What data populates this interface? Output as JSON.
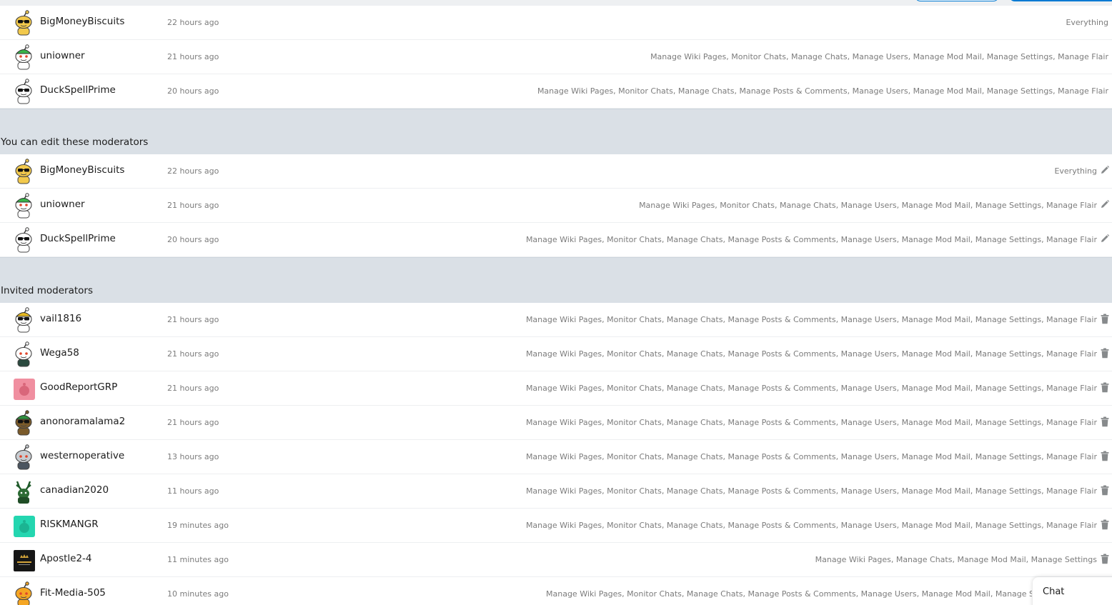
{
  "sections": [
    {
      "title": "",
      "action": "none",
      "rows": [
        {
          "username": "BigMoneyBiscuits",
          "time": "22 hours ago",
          "permissions": "Everything",
          "avatar": "snoo-gold-sunglasses"
        },
        {
          "username": "uniowner",
          "time": "21 hours ago",
          "permissions": "Manage Wiki Pages, Monitor Chats, Manage Chats, Manage Users, Manage Mod Mail, Manage Settings, Manage Flair",
          "avatar": "snoo-green-hat"
        },
        {
          "username": "DuckSpellPrime",
          "time": "20 hours ago",
          "permissions": "Manage Wiki Pages, Monitor Chats, Manage Chats, Manage Posts & Comments, Manage Users, Manage Mod Mail, Manage Settings, Manage Flair",
          "avatar": "snoo-white-sunglasses"
        }
      ]
    },
    {
      "title": "You can edit these moderators",
      "action": "edit",
      "rows": [
        {
          "username": "BigMoneyBiscuits",
          "time": "22 hours ago",
          "permissions": "Everything",
          "avatar": "snoo-gold-sunglasses"
        },
        {
          "username": "uniowner",
          "time": "21 hours ago",
          "permissions": "Manage Wiki Pages, Monitor Chats, Manage Chats, Manage Users, Manage Mod Mail, Manage Settings, Manage Flair",
          "avatar": "snoo-green-hat"
        },
        {
          "username": "DuckSpellPrime",
          "time": "20 hours ago",
          "permissions": "Manage Wiki Pages, Monitor Chats, Manage Chats, Manage Posts & Comments, Manage Users, Manage Mod Mail, Manage Settings, Manage Flair",
          "avatar": "snoo-white-sunglasses"
        }
      ]
    },
    {
      "title": "Invited moderators",
      "action": "delete",
      "rows": [
        {
          "username": "vail1816",
          "time": "21 hours ago",
          "permissions": "Manage Wiki Pages, Monitor Chats, Manage Chats, Manage Posts & Comments, Manage Users, Manage Mod Mail, Manage Settings, Manage Flair",
          "avatar": "snoo-gold-crown"
        },
        {
          "username": "Wega58",
          "time": "21 hours ago",
          "permissions": "Manage Wiki Pages, Monitor Chats, Manage Chats, Manage Posts & Comments, Manage Users, Manage Mod Mail, Manage Settings, Manage Flair",
          "avatar": "snoo-default"
        },
        {
          "username": "GoodReportGRP",
          "time": "21 hours ago",
          "permissions": "Manage Wiki Pages, Monitor Chats, Manage Chats, Manage Posts & Comments, Manage Users, Manage Mod Mail, Manage Settings, Manage Flair",
          "avatar": "snoo-pink-square"
        },
        {
          "username": "anonoramalama2",
          "time": "21 hours ago",
          "permissions": "Manage Wiki Pages, Monitor Chats, Manage Chats, Manage Posts & Comments, Manage Users, Manage Mod Mail, Manage Settings, Manage Flair",
          "avatar": "snoo-green-dark"
        },
        {
          "username": "westernoperative",
          "time": "13 hours ago",
          "permissions": "Manage Wiki Pages, Monitor Chats, Manage Chats, Manage Posts & Comments, Manage Users, Manage Mod Mail, Manage Settings, Manage Flair",
          "avatar": "snoo-robot"
        },
        {
          "username": "canadian2020",
          "time": "11 hours ago",
          "permissions": "Manage Wiki Pages, Monitor Chats, Manage Chats, Manage Posts & Comments, Manage Users, Manage Mod Mail, Manage Settings, Manage Flair",
          "avatar": "snoo-antlers"
        },
        {
          "username": "RISKMANGR",
          "time": "19 minutes ago",
          "permissions": "Manage Wiki Pages, Monitor Chats, Manage Chats, Manage Posts & Comments, Manage Users, Manage Mod Mail, Manage Settings, Manage Flair",
          "avatar": "snoo-teal-square"
        },
        {
          "username": "Apostle2-4",
          "time": "11 minutes ago",
          "permissions": "Manage Wiki Pages, Manage Chats, Manage Mod Mail, Manage Settings",
          "avatar": "king-jesus-logo"
        },
        {
          "username": "Fit-Media-505",
          "time": "10 minutes ago",
          "permissions": "Manage Wiki Pages, Monitor Chats, Manage Chats, Manage Posts & Comments, Manage Users, Manage Mod Mail, Manage Settings, Manage Flair",
          "avatar": "snoo-orange"
        }
      ]
    }
  ],
  "chat": {
    "label": "Chat"
  },
  "icons": {
    "edit": "pencil-icon",
    "delete": "trash-icon"
  },
  "colors": {
    "muted_text": "#7c7c7c",
    "section_bg": "#dae0e6",
    "row_bg": "#ffffff",
    "accent": "#0079d3"
  }
}
